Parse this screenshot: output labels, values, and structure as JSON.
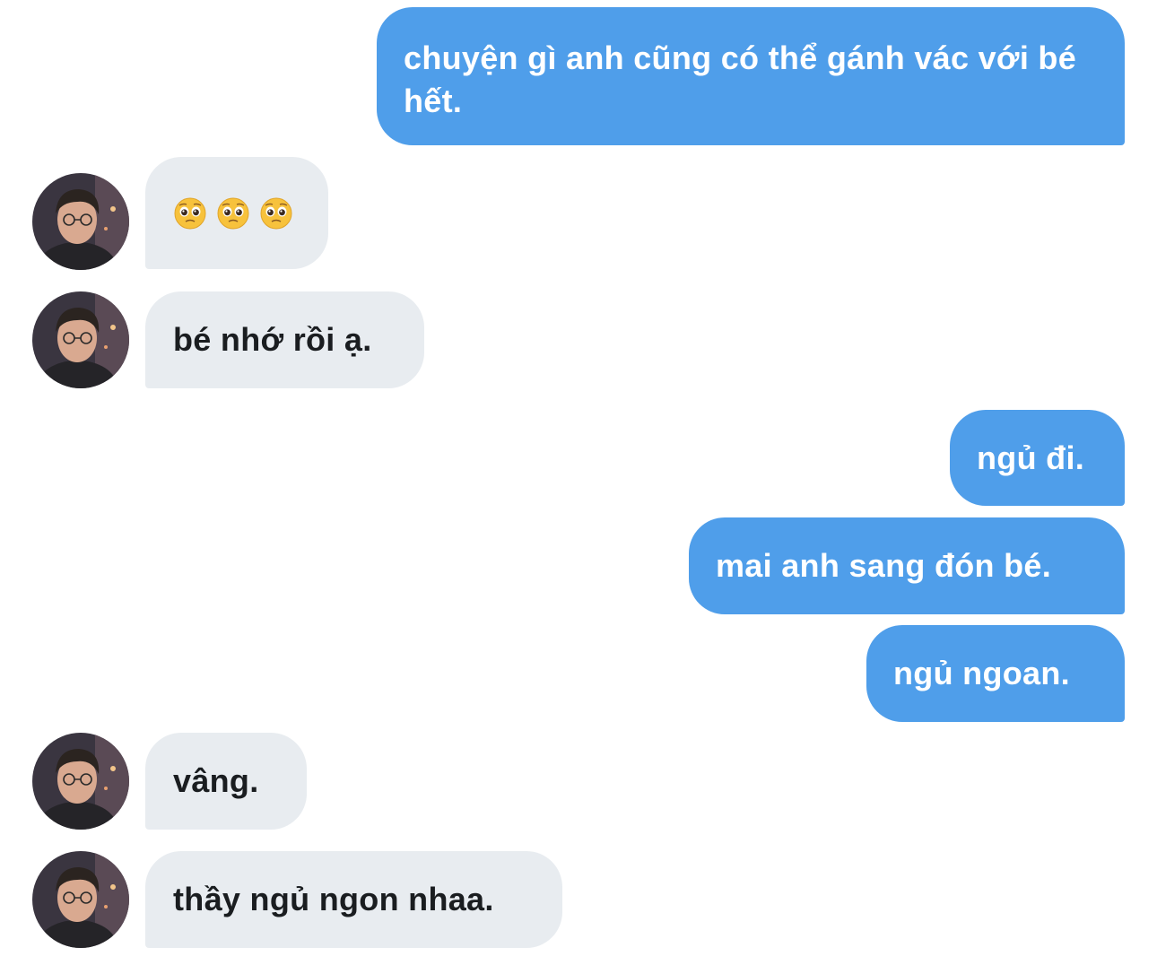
{
  "conversation": {
    "messages": [
      {
        "side": "out",
        "text": "chuyện gì anh cũng có thể gánh vác với bé hết."
      },
      {
        "side": "in",
        "emoji": [
          "pleading-face",
          "pleading-face",
          "pleading-face"
        ]
      },
      {
        "side": "in",
        "text": "bé nhớ rồi ạ."
      },
      {
        "side": "out",
        "text": "ngủ đi."
      },
      {
        "side": "out",
        "text": "mai anh sang đón bé."
      },
      {
        "side": "out",
        "text": "ngủ ngoan."
      },
      {
        "side": "in",
        "text": "vâng."
      },
      {
        "side": "in",
        "text": "thầy ngủ ngon nhaa."
      }
    ]
  },
  "colors": {
    "outgoing_bubble": "#4f9eea",
    "incoming_bubble": "#e8ecf0",
    "background": "#ffffff"
  }
}
